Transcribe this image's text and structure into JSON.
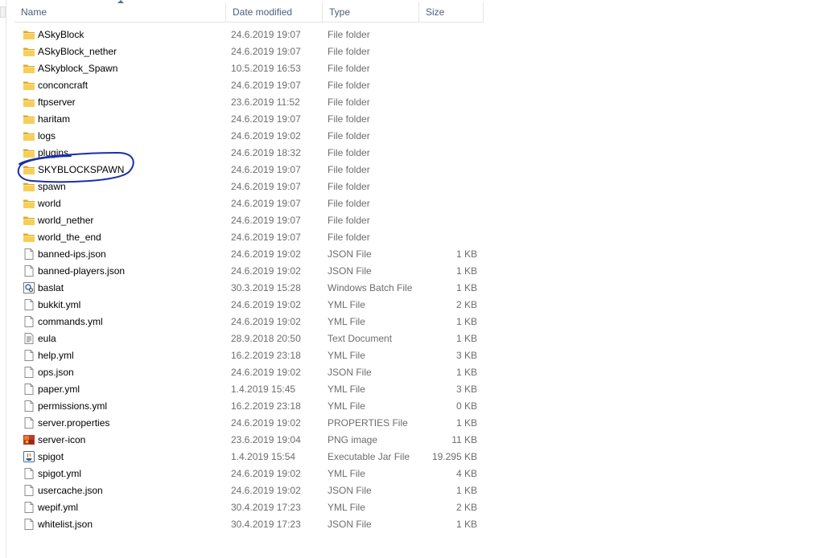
{
  "columns": {
    "name": "Name",
    "date": "Date modified",
    "type": "Type",
    "size": "Size"
  },
  "files": [
    {
      "icon": "folder-icon",
      "name": "ASkyBlock",
      "date": "24.6.2019 19:07",
      "type": "File folder",
      "size": ""
    },
    {
      "icon": "folder-icon",
      "name": "ASkyBlock_nether",
      "date": "24.6.2019 19:07",
      "type": "File folder",
      "size": ""
    },
    {
      "icon": "folder-icon",
      "name": "ASkyblock_Spawn",
      "date": "10.5.2019 16:53",
      "type": "File folder",
      "size": ""
    },
    {
      "icon": "folder-icon",
      "name": "conconcraft",
      "date": "24.6.2019 19:07",
      "type": "File folder",
      "size": ""
    },
    {
      "icon": "folder-icon",
      "name": "ftpserver",
      "date": "23.6.2019 11:52",
      "type": "File folder",
      "size": ""
    },
    {
      "icon": "folder-icon",
      "name": "haritam",
      "date": "24.6.2019 19:07",
      "type": "File folder",
      "size": ""
    },
    {
      "icon": "folder-icon",
      "name": "logs",
      "date": "24.6.2019 19:02",
      "type": "File folder",
      "size": ""
    },
    {
      "icon": "folder-icon",
      "name": "plugins",
      "date": "24.6.2019 18:32",
      "type": "File folder",
      "size": ""
    },
    {
      "icon": "folder-icon",
      "name": "SKYBLOCKSPAWN",
      "date": "24.6.2019 19:07",
      "type": "File folder",
      "size": ""
    },
    {
      "icon": "folder-icon",
      "name": "spawn",
      "date": "24.6.2019 19:07",
      "type": "File folder",
      "size": ""
    },
    {
      "icon": "folder-icon",
      "name": "world",
      "date": "24.6.2019 19:07",
      "type": "File folder",
      "size": ""
    },
    {
      "icon": "folder-icon",
      "name": "world_nether",
      "date": "24.6.2019 19:07",
      "type": "File folder",
      "size": ""
    },
    {
      "icon": "folder-icon",
      "name": "world_the_end",
      "date": "24.6.2019 19:07",
      "type": "File folder",
      "size": ""
    },
    {
      "icon": "file-icon",
      "name": "banned-ips.json",
      "date": "24.6.2019 19:02",
      "type": "JSON File",
      "size": "1 KB"
    },
    {
      "icon": "file-icon",
      "name": "banned-players.json",
      "date": "24.6.2019 19:02",
      "type": "JSON File",
      "size": "1 KB"
    },
    {
      "icon": "batch-file-icon",
      "name": "baslat",
      "date": "30.3.2019 15:28",
      "type": "Windows Batch File",
      "size": "1 KB"
    },
    {
      "icon": "file-icon",
      "name": "bukkit.yml",
      "date": "24.6.2019 19:02",
      "type": "YML File",
      "size": "2 KB"
    },
    {
      "icon": "file-icon",
      "name": "commands.yml",
      "date": "24.6.2019 19:02",
      "type": "YML File",
      "size": "1 KB"
    },
    {
      "icon": "text-document-icon",
      "name": "eula",
      "date": "28.9.2018 20:50",
      "type": "Text Document",
      "size": "1 KB"
    },
    {
      "icon": "file-icon",
      "name": "help.yml",
      "date": "16.2.2019 23:18",
      "type": "YML File",
      "size": "3 KB"
    },
    {
      "icon": "file-icon",
      "name": "ops.json",
      "date": "24.6.2019 19:02",
      "type": "JSON File",
      "size": "1 KB"
    },
    {
      "icon": "file-icon",
      "name": "paper.yml",
      "date": "1.4.2019 15:45",
      "type": "YML File",
      "size": "3 KB"
    },
    {
      "icon": "file-icon",
      "name": "permissions.yml",
      "date": "16.2.2019 23:18",
      "type": "YML File",
      "size": "0 KB"
    },
    {
      "icon": "file-icon",
      "name": "server.properties",
      "date": "24.6.2019 19:02",
      "type": "PROPERTIES File",
      "size": "1 KB"
    },
    {
      "icon": "image-icon",
      "name": "server-icon",
      "date": "23.6.2019 19:04",
      "type": "PNG image",
      "size": "11 KB"
    },
    {
      "icon": "java-jar-icon",
      "name": "spigot",
      "date": "1.4.2019 15:54",
      "type": "Executable Jar File",
      "size": "19.295 KB"
    },
    {
      "icon": "file-icon",
      "name": "spigot.yml",
      "date": "24.6.2019 19:02",
      "type": "YML File",
      "size": "4 KB"
    },
    {
      "icon": "file-icon",
      "name": "usercache.json",
      "date": "24.6.2019 19:02",
      "type": "JSON File",
      "size": "1 KB"
    },
    {
      "icon": "file-icon",
      "name": "wepif.yml",
      "date": "30.4.2019 17:23",
      "type": "YML File",
      "size": "2 KB"
    },
    {
      "icon": "file-icon",
      "name": "whitelist.json",
      "date": "30.4.2019 17:23",
      "type": "JSON File",
      "size": "1 KB"
    }
  ],
  "annotation": {
    "color": "#1a2fa8",
    "highlighted_item": "SKYBLOCKSPAWN"
  },
  "colors": {
    "header_text": "#4c607a",
    "folder_yellow": "#e8b93a",
    "muted_text": "#6d6d6d"
  }
}
